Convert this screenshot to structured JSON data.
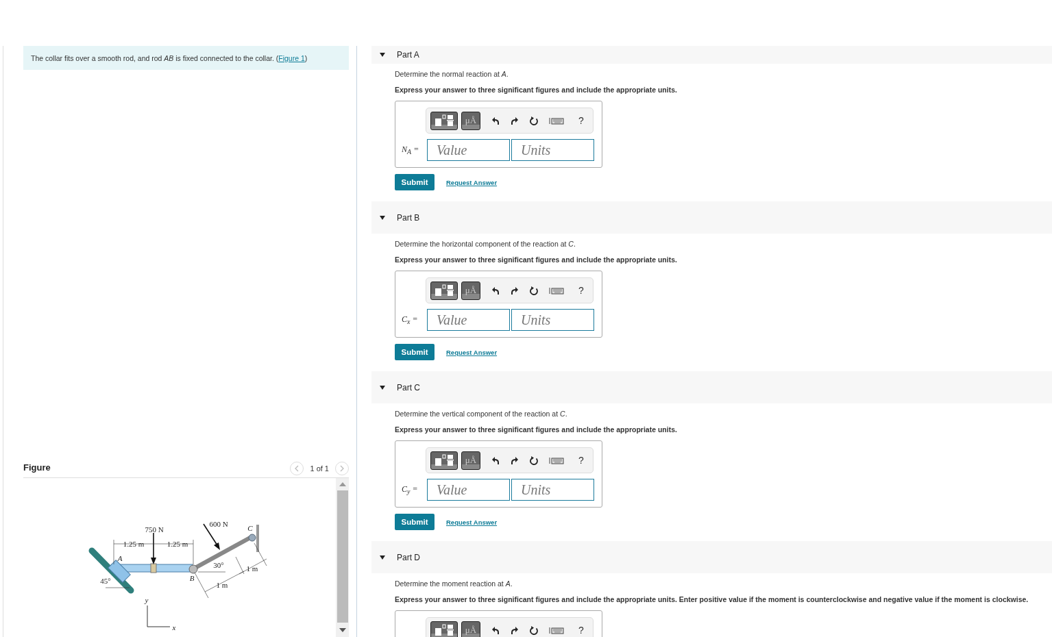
{
  "intro": {
    "text": "The collar fits over a smooth rod, and rod *AB* is fixed connected to the collar. (",
    "link": "Figure 1",
    "after": ")"
  },
  "figure": {
    "title": "Figure",
    "pager": "1 of 1",
    "labels": [
      "750 N",
      "600 N",
      "C",
      "A",
      "B",
      "30°",
      "1 m",
      "1 m",
      "45°",
      "y",
      "x",
      "1.25 m",
      "1.25 m"
    ]
  },
  "parts": [
    {
      "title": "Part A",
      "expanded": true,
      "question": "Determine the normal reaction at *A*.",
      "instruction": "Express your answer to three significant figures and include the appropriate units.",
      "units_symbol": "μÅ",
      "help": "?",
      "variable": "N$_{A}$ =",
      "value_placeholder": "Value",
      "units_placeholder": "Units",
      "submit": "Submit",
      "request": "Request Answer"
    },
    {
      "title": "Part B",
      "expanded": true,
      "question": "Determine the horizontal component of the reaction at *C*.",
      "instruction": "Express your answer to three significant figures and include the appropriate units.",
      "units_symbol": "μÅ",
      "help": "?",
      "variable": "C$_{x}$ =",
      "value_placeholder": "Value",
      "units_placeholder": "Units",
      "submit": "Submit",
      "request": "Request Answer"
    },
    {
      "title": "Part C",
      "expanded": true,
      "question": "Determine the vertical component of the reaction at *C*.",
      "instruction": "Express your answer to three significant figures and include the appropriate units.",
      "units_symbol": "μÅ",
      "help": "?",
      "variable": "C$_{y}$ =",
      "value_placeholder": "Value",
      "units_placeholder": "Units",
      "submit": "Submit",
      "request": "Request Answer"
    },
    {
      "title": "Part D",
      "expanded": true,
      "question": "Determine the moment reaction at *A*.",
      "instruction": "Express your answer to three significant figures and include the appropriate units. Enter positive value if the moment is counterclockwise and negative value if the moment is clockwise.",
      "units_symbol": "μÅ",
      "help": "?"
    }
  ]
}
